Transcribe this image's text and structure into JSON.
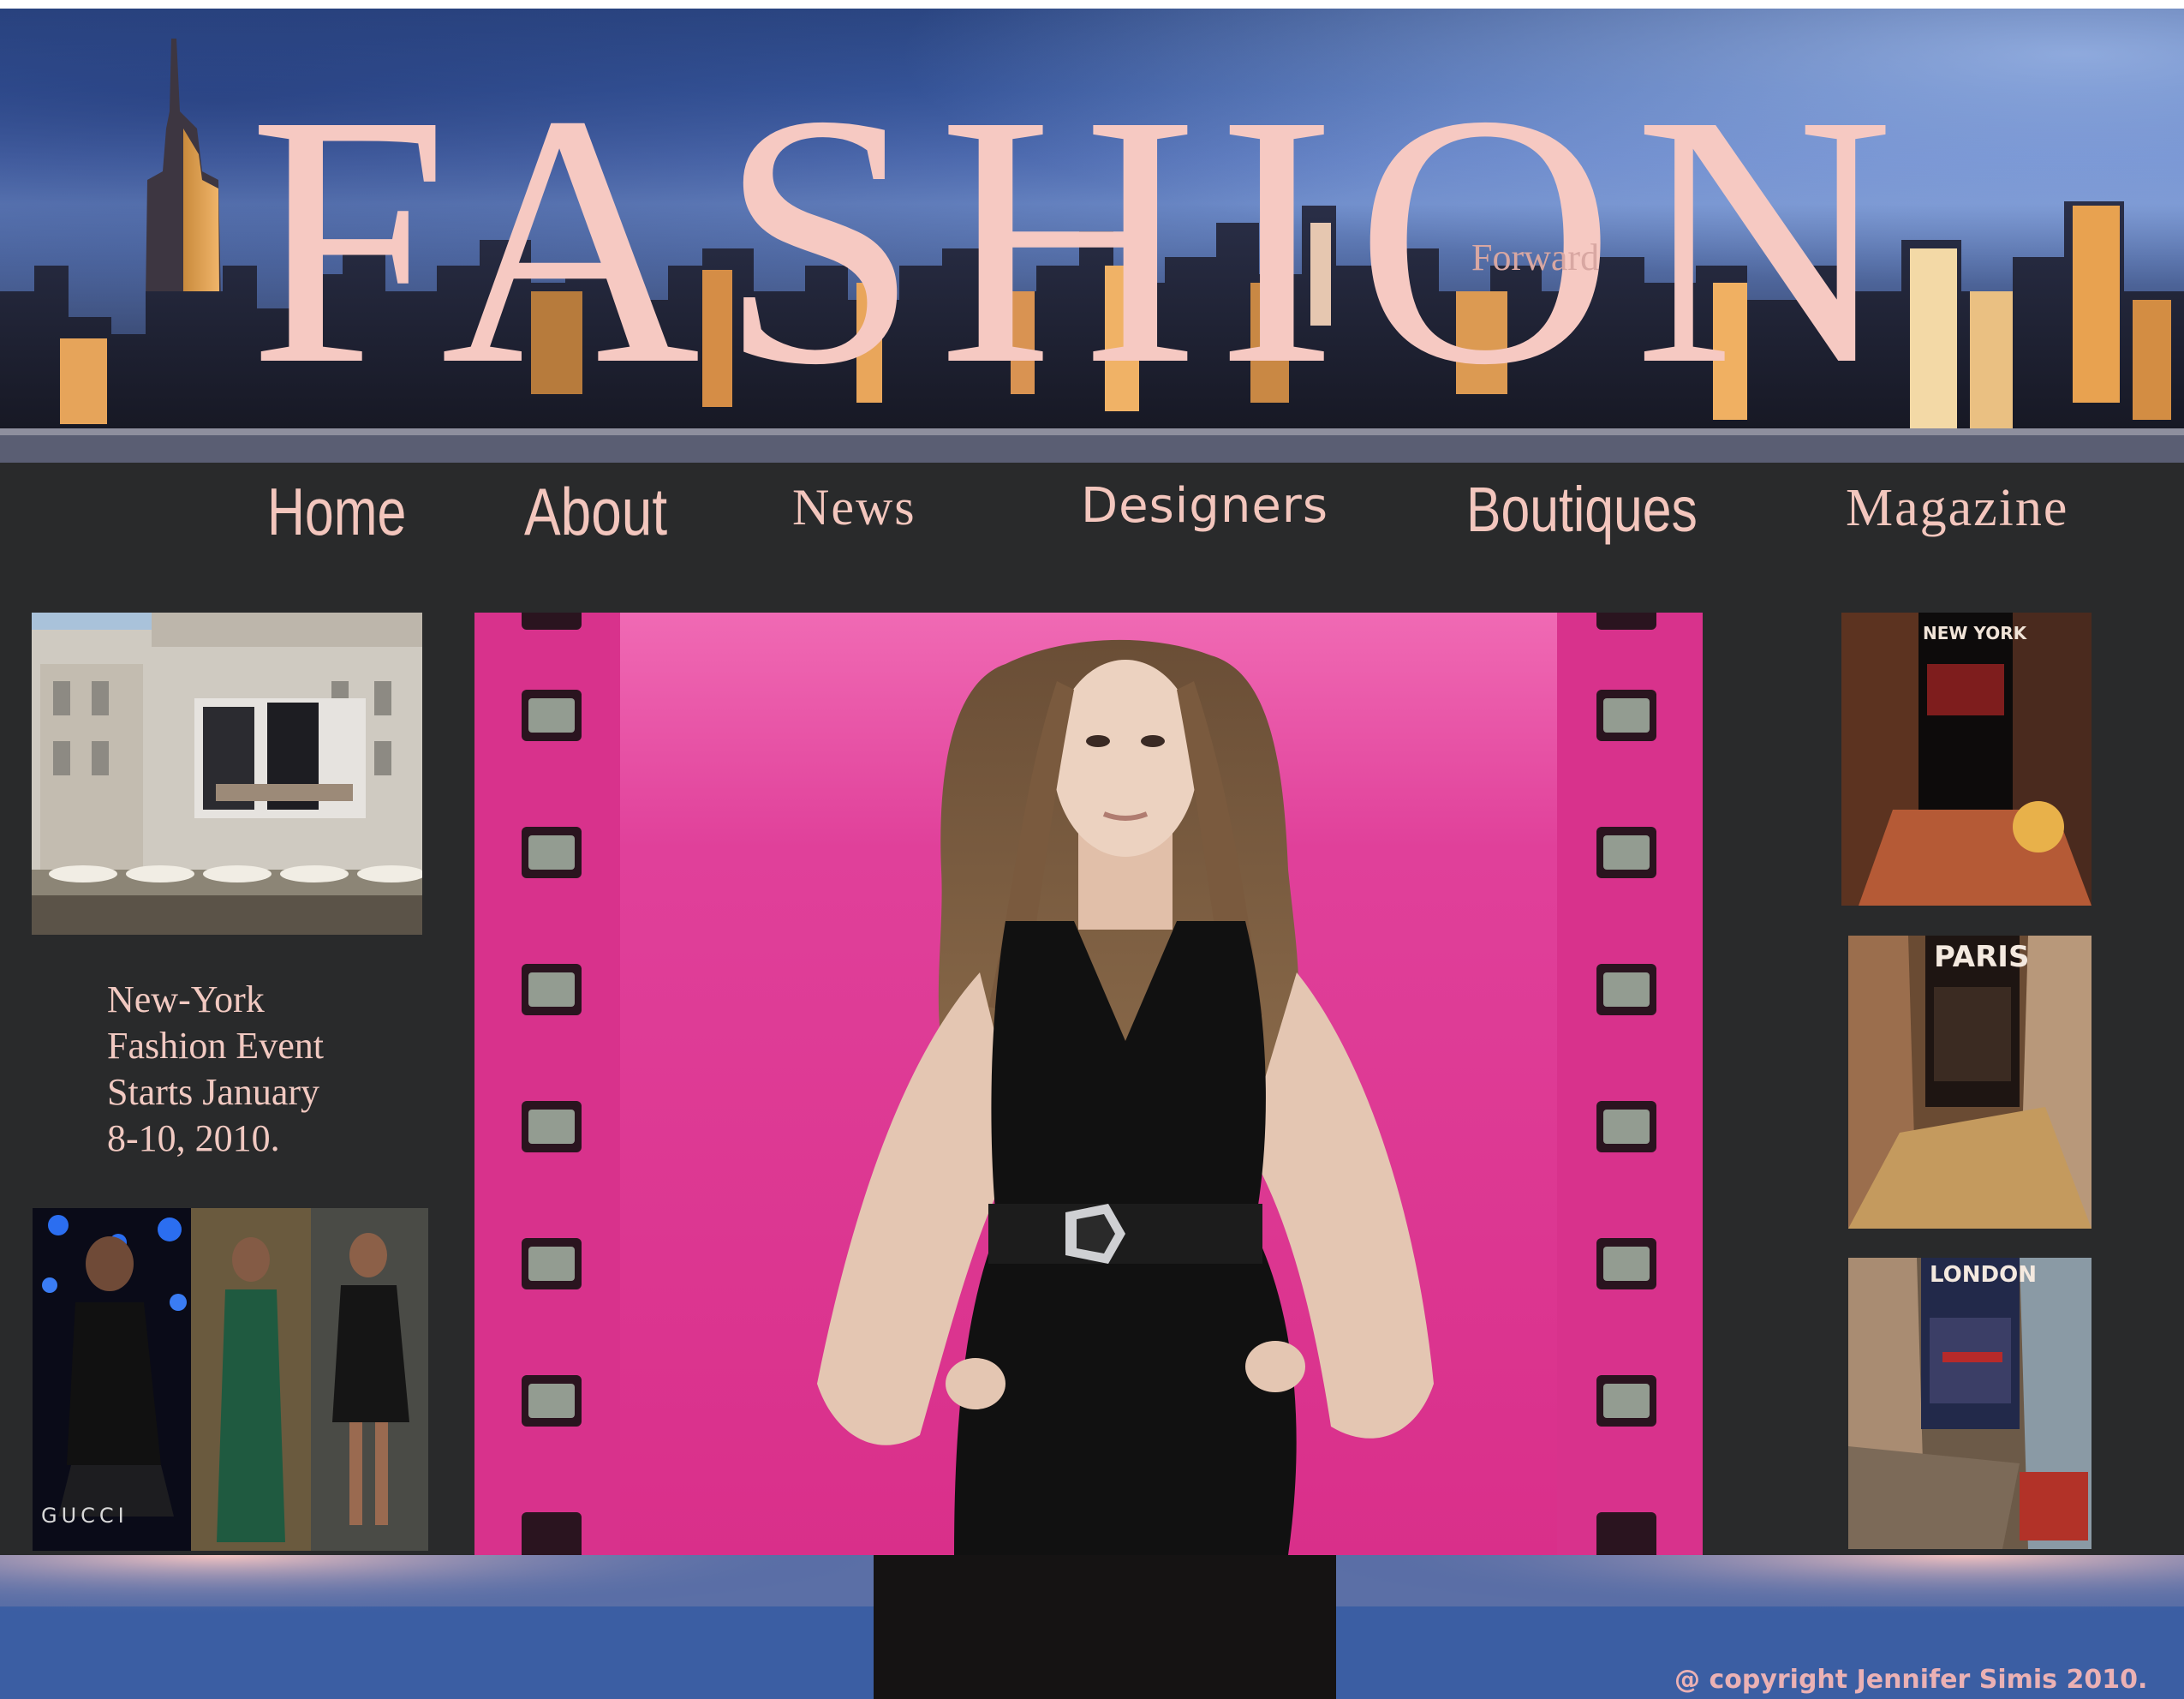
{
  "header": {
    "title": "FASHION",
    "subtitle": "Forward"
  },
  "nav": {
    "items": [
      {
        "label": "Home"
      },
      {
        "label": "About"
      },
      {
        "label": "News"
      },
      {
        "label": "Designers"
      },
      {
        "label": "Boutiques"
      },
      {
        "label": "Magazine"
      }
    ]
  },
  "sidebar_left": {
    "event_lines": [
      "New-York",
      "Fashion Event",
      "Starts January",
      "8-10, 2010."
    ],
    "gucci_caption": "GUCCI"
  },
  "sidebar_right": {
    "posters": [
      {
        "city": "NEW YORK"
      },
      {
        "city": "PARIS"
      },
      {
        "city": "LONDON"
      }
    ]
  },
  "footer": {
    "copyright": "@ copyright Jennifer Simis 2010."
  },
  "colors": {
    "title_pink": "#f6c9c2",
    "nav_pink": "#f3c6bd",
    "background_dark": "#292a2b",
    "feature_magenta": "#e23f98",
    "footer_blue": "#3b5ea3"
  }
}
